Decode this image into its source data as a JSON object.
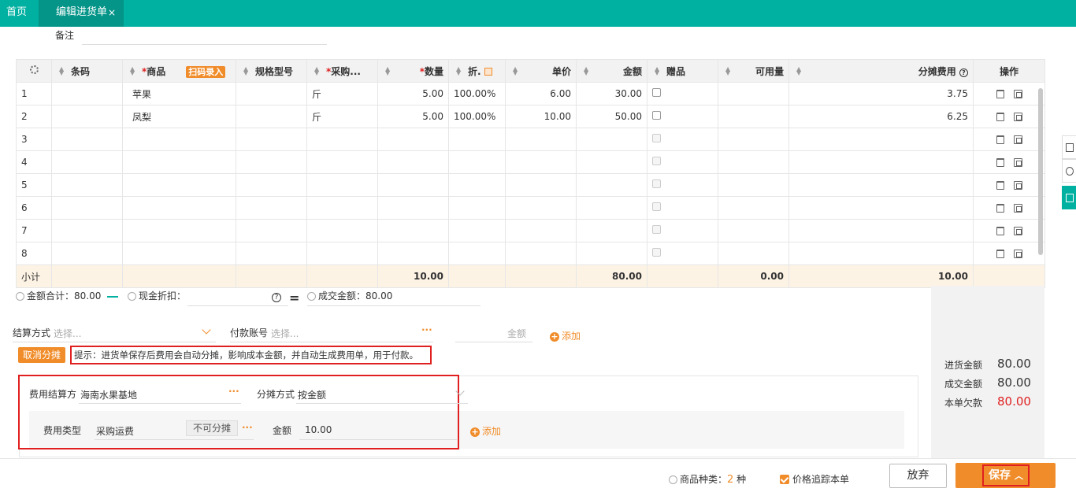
{
  "tabs": [
    {
      "label": "首页"
    },
    {
      "label": "编辑进货单",
      "close": "×"
    }
  ],
  "remark_label": "备注",
  "table": {
    "settings_icon": "gear-icon",
    "headers": [
      "条码",
      "商品",
      "规格型号",
      "采购...",
      "数量",
      "折.",
      "单价",
      "金额",
      "赠品",
      "可用量",
      "分摊费用",
      "操作"
    ],
    "scan_label": "扫码录入",
    "rows": [
      {
        "no": "1",
        "barcode": "",
        "product": "苹果",
        "spec": "",
        "unit": "斤",
        "qty": "5.00",
        "disc": "100.00%",
        "price": "6.00",
        "amount": "30.00",
        "gift": false,
        "avail": "",
        "alloc": "3.75"
      },
      {
        "no": "2",
        "barcode": "",
        "product": "凤梨",
        "spec": "",
        "unit": "斤",
        "qty": "5.00",
        "disc": "100.00%",
        "price": "10.00",
        "amount": "50.00",
        "gift": false,
        "avail": "",
        "alloc": "6.25"
      },
      {
        "no": "3",
        "barcode": "",
        "product": "",
        "spec": "",
        "unit": "",
        "qty": "",
        "disc": "",
        "price": "",
        "amount": "",
        "gift": false,
        "avail": "",
        "alloc": ""
      },
      {
        "no": "4",
        "barcode": "",
        "product": "",
        "spec": "",
        "unit": "",
        "qty": "",
        "disc": "",
        "price": "",
        "amount": "",
        "gift": false,
        "avail": "",
        "alloc": ""
      },
      {
        "no": "5",
        "barcode": "",
        "product": "",
        "spec": "",
        "unit": "",
        "qty": "",
        "disc": "",
        "price": "",
        "amount": "",
        "gift": false,
        "avail": "",
        "alloc": ""
      },
      {
        "no": "6",
        "barcode": "",
        "product": "",
        "spec": "",
        "unit": "",
        "qty": "",
        "disc": "",
        "price": "",
        "amount": "",
        "gift": false,
        "avail": "",
        "alloc": ""
      },
      {
        "no": "7",
        "barcode": "",
        "product": "",
        "spec": "",
        "unit": "",
        "qty": "",
        "disc": "",
        "price": "",
        "amount": "",
        "gift": false,
        "avail": "",
        "alloc": ""
      },
      {
        "no": "8",
        "barcode": "",
        "product": "",
        "spec": "",
        "unit": "",
        "qty": "",
        "disc": "",
        "price": "",
        "amount": "",
        "gift": false,
        "avail": "",
        "alloc": ""
      }
    ],
    "subtotal": {
      "label": "小计",
      "qty": "10.00",
      "amount": "80.00",
      "avail": "0.00",
      "alloc": "10.00"
    }
  },
  "summary": {
    "total_label": "金额合计：80.00",
    "discount_label": "现金折扣：",
    "deal_label": "成交金额：80.00"
  },
  "settlement": {
    "label": "结算方式",
    "placeholder": "选择...",
    "account_label": "付款账号",
    "account_placeholder": "选择...",
    "amount_placeholder": "金额",
    "add_label": "添加"
  },
  "cancel_alloc_label": "取消分摊",
  "hint": "提示：进货单保存后费用会自动分摊，影响成本金额，并自动生成费用单，用于付款。",
  "expense": {
    "settle_label": "费用结算方",
    "settle_value": "海南水果基地",
    "alloc_method_label": "分摊方式",
    "alloc_method_value": "按金额",
    "type_label": "费用类型",
    "type_value": "采购运费",
    "nosplit_label": "不可分摊",
    "amount_label": "金额",
    "amount_value": "10.00",
    "add_label": "添加"
  },
  "right_summary": [
    {
      "label": "进货金额",
      "value": "80.00",
      "color": "#333333"
    },
    {
      "label": "成交金额",
      "value": "80.00",
      "color": "#333333"
    },
    {
      "label": "本单欠款",
      "value": "80.00",
      "color": "#e02020"
    }
  ],
  "footer": {
    "kinds_label": "商品种类：",
    "kinds_value": "2",
    "kinds_unit": "种",
    "trace_label": "价格追踪本单",
    "giveup_label": "放弃",
    "save_label": "保存"
  },
  "colors": {
    "brand": "#00b0a0",
    "accent": "#f08c2a",
    "alert": "#e02020"
  }
}
